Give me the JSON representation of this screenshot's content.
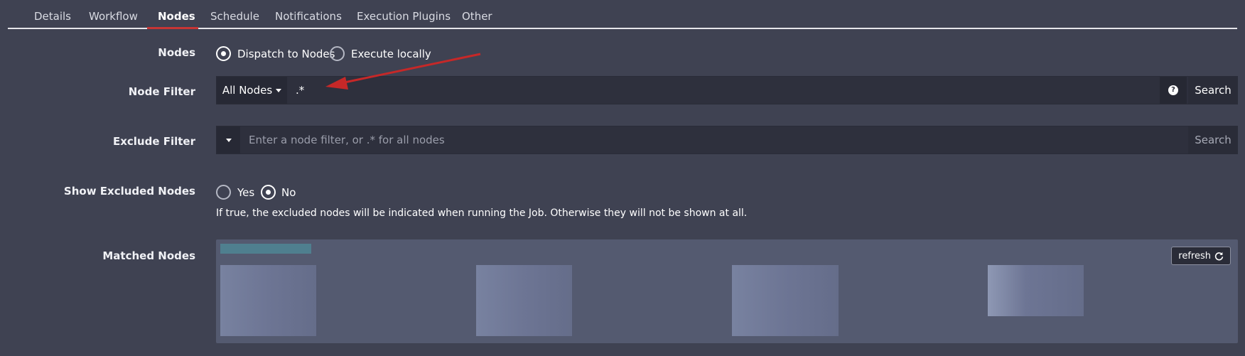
{
  "tabs": [
    {
      "label": "Details"
    },
    {
      "label": "Workflow"
    },
    {
      "label": "Nodes"
    },
    {
      "label": "Schedule"
    },
    {
      "label": "Notifications"
    },
    {
      "label": "Execution Plugins"
    },
    {
      "label": "Other"
    }
  ],
  "active_tab": "Nodes",
  "nodes_field": {
    "label": "Nodes",
    "options": [
      {
        "label": "Dispatch to Nodes",
        "checked": true
      },
      {
        "label": "Execute locally",
        "checked": false
      }
    ]
  },
  "node_filter": {
    "label": "Node Filter",
    "dropdown_label": "All Nodes",
    "value": ".*",
    "help_icon": "question-circle-icon",
    "search_label": "Search"
  },
  "exclude_filter": {
    "label": "Exclude Filter",
    "placeholder": "Enter a node filter, or .* for all nodes",
    "search_label": "Search"
  },
  "show_excluded": {
    "label": "Show Excluded Nodes",
    "options": [
      {
        "label": "Yes",
        "checked": false
      },
      {
        "label": "No",
        "checked": true
      }
    ],
    "help": "If true, the excluded nodes will be indicated when running the Job. Otherwise they will not be shown at all."
  },
  "matched_nodes": {
    "label": "Matched Nodes",
    "refresh_label": "refresh",
    "refresh_icon": "refresh-icon"
  },
  "colors": {
    "background": "#3f4252",
    "accent_underline": "#c73535",
    "input_bg": "#2e303d",
    "matched_bg": "#545a70",
    "annotation_arrow": "#c62828"
  }
}
